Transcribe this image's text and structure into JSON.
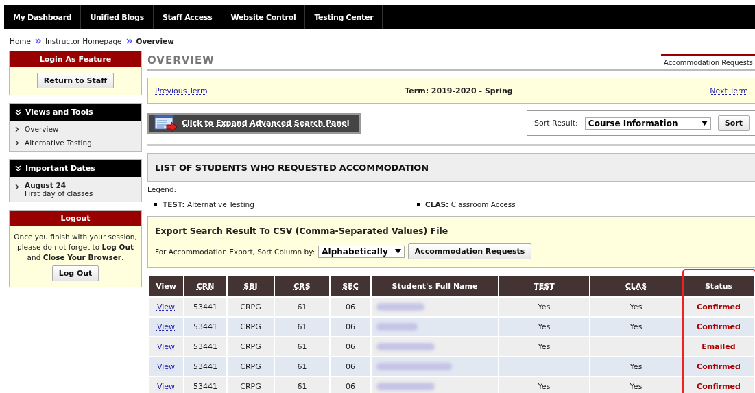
{
  "top_nav": [
    {
      "label": "My Dashboard"
    },
    {
      "label": "Unified Blogs"
    },
    {
      "label": "Staff Access"
    },
    {
      "label": "Website Control"
    },
    {
      "label": "Testing Center"
    }
  ],
  "breadcrumb": [
    "Home",
    "Instructor Homepage",
    "Overview"
  ],
  "sidebar": {
    "login_as": {
      "title": "Login As Feature",
      "button": "Return to Staff"
    },
    "views": {
      "title": "Views and Tools",
      "items": [
        {
          "label": "Overview"
        },
        {
          "label": "Alternative Testing"
        }
      ]
    },
    "dates": {
      "title": "Important Dates",
      "items": [
        {
          "date": "August 24",
          "description": "First day of classes"
        }
      ]
    },
    "logout": {
      "title": "Logout",
      "message": "Once you finish with your session, please do not forget to **Log Out** and **Close Your Browser**.",
      "button": "Log Out"
    }
  },
  "page_title": "OVERVIEW",
  "tabs": [
    {
      "label": "Accommodation Requests",
      "selected": true
    }
  ],
  "term_bar": {
    "previous": "Previous Term",
    "term": "Term: 2019-2020 - Spring",
    "next": "Next Term"
  },
  "advanced_search": "Click to Expand Advanced Search Panel",
  "sort": {
    "label": "Sort Result:",
    "value": "Course Information",
    "button": "Sort"
  },
  "list_title": "LIST OF STUDENTS WHO REQUESTED ACCOMMODATION",
  "legend": {
    "label": "Legend:",
    "items": [
      {
        "code": "TEST:",
        "meaning": "Alternative Testing"
      },
      {
        "code": "CLAS:",
        "meaning": "Classroom Access"
      }
    ]
  },
  "export": {
    "title": "Export Search Result To CSV (Comma-Separated Values) File",
    "label": "For Accommodation Export, Sort Column by:",
    "value": "Alphabetically",
    "button": "Accommodation Requests"
  },
  "table": {
    "columns": [
      {
        "label": "View",
        "sortable": false
      },
      {
        "label": "CRN",
        "sortable": true
      },
      {
        "label": "SBJ",
        "sortable": true
      },
      {
        "label": "CRS",
        "sortable": true
      },
      {
        "label": "SEC",
        "sortable": true
      },
      {
        "label": "Student's Full Name",
        "sortable": false
      },
      {
        "label": "TEST",
        "sortable": true
      },
      {
        "label": "CLAS",
        "sortable": true
      },
      {
        "label": "Status",
        "sortable": false
      }
    ],
    "rows": [
      {
        "view": "View",
        "crn": "53441",
        "sbj": "CRPG",
        "crs": "61",
        "sec": "06",
        "test": "Yes",
        "clas": "Yes",
        "status": "Confirmed"
      },
      {
        "view": "View",
        "crn": "53441",
        "sbj": "CRPG",
        "crs": "61",
        "sec": "06",
        "test": "Yes",
        "clas": "Yes",
        "status": "Confirmed"
      },
      {
        "view": "View",
        "crn": "53441",
        "sbj": "CRPG",
        "crs": "61",
        "sec": "06",
        "test": "Yes",
        "status": "Emailed"
      },
      {
        "view": "View",
        "crn": "53441",
        "sbj": "CRPG",
        "crs": "61",
        "sec": "06",
        "clas": "Yes",
        "status": "Confirmed"
      },
      {
        "view": "View",
        "crn": "53441",
        "sbj": "CRPG",
        "crs": "61",
        "sec": "06",
        "test": "Yes",
        "clas": "Yes",
        "status": "Confirmed"
      }
    ]
  }
}
